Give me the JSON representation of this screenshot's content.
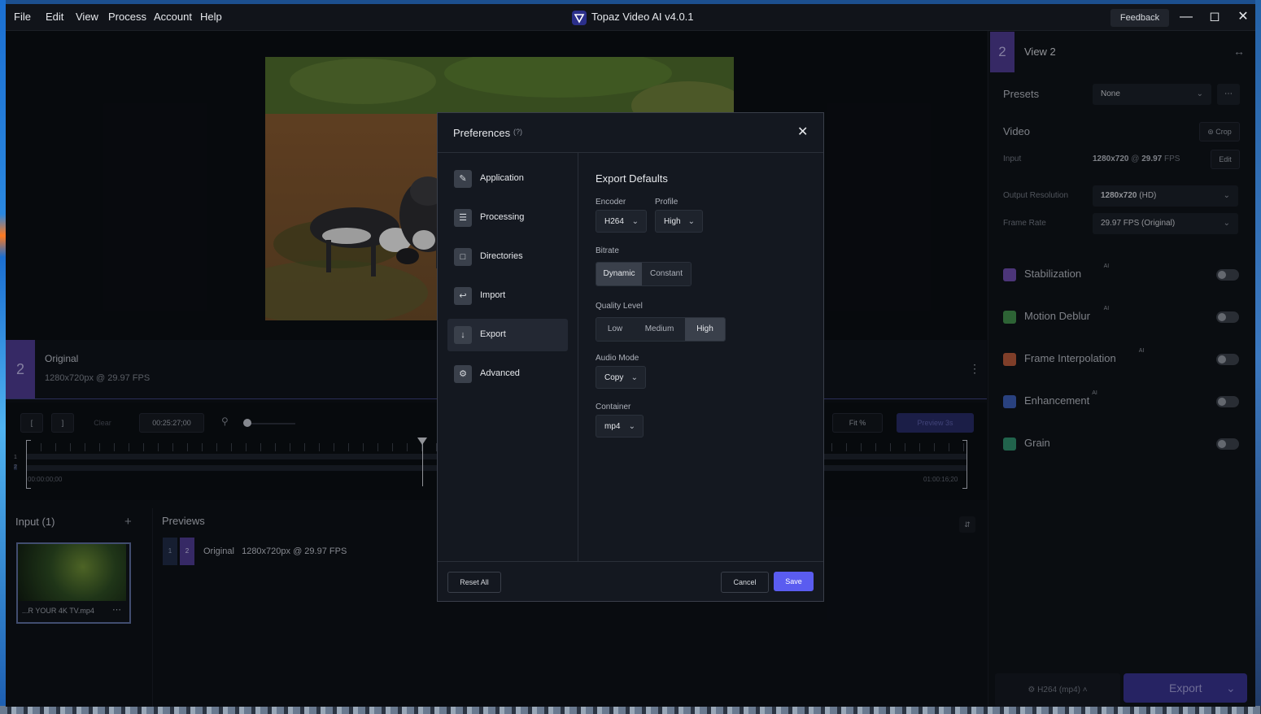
{
  "window": {
    "title": "Topaz Video AI  v4.0.1",
    "menu": [
      "File",
      "Edit",
      "View",
      "Process",
      "Account",
      "Help"
    ],
    "feedback_label": "Feedback"
  },
  "original": {
    "badge": "2",
    "title": "Original",
    "info": "1280x720px @ 29.97 FPS"
  },
  "timeline": {
    "in_btn": "[",
    "out_btn": "]",
    "clear_btn": "Clear",
    "timecode": "00:25:27;00",
    "start_time": "00:00:00;00",
    "end_time": "01:00:16;20",
    "fit_label": "Fit %",
    "preview_label": "Preview 3s",
    "track_labels": [
      "1",
      "2"
    ]
  },
  "input_panel": {
    "title": "Input (1)",
    "add_icon": "+",
    "file_name": "...R YOUR 4K TV.mp4",
    "more_icon": "⋯"
  },
  "previews_panel": {
    "title": "Previews",
    "badge1": "1",
    "badge2": "2",
    "label": "Original",
    "info": "1280x720px @ 29.97 FPS"
  },
  "right_panel": {
    "view_badge": "2",
    "view_title": "View 2",
    "presets_label": "Presets",
    "presets_value": "None",
    "video_label": "Video",
    "crop_label": "Crop",
    "input_label": "Input",
    "input_res": "1280x720",
    "input_at": "@",
    "input_fps": "29.97",
    "input_fps_unit": "FPS",
    "edit_label": "Edit",
    "output_res_label": "Output Resolution",
    "output_res_bold": "1280x720",
    "output_res_suffix": "(HD)",
    "frame_rate_label": "Frame Rate",
    "frame_rate_value": "29.97 FPS (Original)",
    "features": [
      {
        "label": "Stabilization",
        "ai": "AI",
        "color": "#6a4aa8"
      },
      {
        "label": "Motion Deblur",
        "ai": "AI",
        "color": "#3f8a4a"
      },
      {
        "label": "Frame Interpolation",
        "ai": "AI",
        "color": "#b0563a"
      },
      {
        "label": "Enhancement",
        "ai": "AI",
        "color": "#3a5ab0"
      },
      {
        "label": "Grain",
        "ai": "",
        "color": "#2f8a6a"
      }
    ],
    "export_format": "H264 (mp4)",
    "export_label": "Export"
  },
  "preferences": {
    "title": "Preferences",
    "help": "(?)",
    "nav": [
      {
        "label": "Application",
        "icon": "application-icon"
      },
      {
        "label": "Processing",
        "icon": "processing-icon"
      },
      {
        "label": "Directories",
        "icon": "folder-icon"
      },
      {
        "label": "Import",
        "icon": "import-icon"
      },
      {
        "label": "Export",
        "icon": "download-icon"
      },
      {
        "label": "Advanced",
        "icon": "advanced-icon"
      }
    ],
    "active_nav": "Export",
    "section_title": "Export Defaults",
    "encoder_label": "Encoder",
    "encoder_value": "H264",
    "profile_label": "Profile",
    "profile_value": "High",
    "bitrate_label": "Bitrate",
    "bitrate_options": [
      "Dynamic",
      "Constant"
    ],
    "bitrate_selected": "Dynamic",
    "quality_label": "Quality Level",
    "quality_options": [
      "Low",
      "Medium",
      "High"
    ],
    "quality_selected": "High",
    "audio_label": "Audio Mode",
    "audio_value": "Copy",
    "container_label": "Container",
    "container_value": "mp4",
    "reset_label": "Reset All",
    "cancel_label": "Cancel",
    "save_label": "Save"
  },
  "colors": {
    "accent": "#5a5cf0",
    "view_badge": "#4b3a8c",
    "export_button": "#35318a"
  }
}
